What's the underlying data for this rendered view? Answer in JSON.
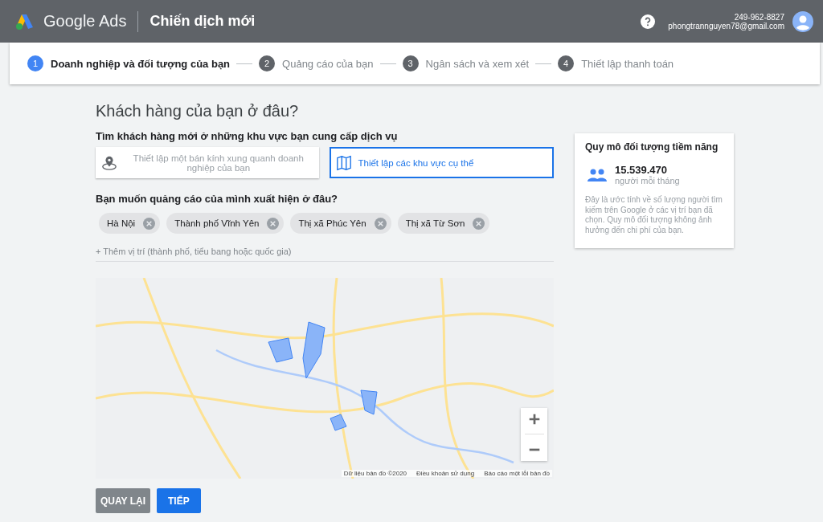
{
  "header": {
    "product": "Google Ads",
    "title": "Chiến dịch mới",
    "account_id": "249-962-8827",
    "email": "phongtrannguyen78@gmail.com"
  },
  "steps": [
    {
      "number": "1",
      "label": "Doanh nghiệp và đối tượng của bạn",
      "selected": true
    },
    {
      "number": "2",
      "label": "Quảng cáo của bạn",
      "selected": false
    },
    {
      "number": "3",
      "label": "Ngân sách và xem xét",
      "selected": false
    },
    {
      "number": "4",
      "label": "Thiết lập thanh toán",
      "selected": false
    }
  ],
  "page_title": "Khách hàng của bạn ở đâu?",
  "area_question": "Tìm khách hàng mới ở những khu vực bạn cung cấp dịch vụ",
  "area_options": [
    {
      "kind": "radius",
      "label": "Thiết lập một bán kính xung quanh doanh nghiệp của bạn",
      "selected": false
    },
    {
      "kind": "regions",
      "label": "Thiết lập các khu vực cụ thể",
      "selected": true
    }
  ],
  "location_question": "Bạn muốn quảng cáo của mình xuất hiện ở đâu?",
  "locations": [
    "Hà Nội",
    "Thành phố Vĩnh Yên",
    "Thị xã Phúc Yên",
    "Thị xã Từ Sơn"
  ],
  "add_location": "+ Thêm vị trí (thành phố, tiểu bang hoặc quốc gia)",
  "map": {
    "footer": [
      "Dữ liệu bản đồ ©2020",
      "Điều khoản sử dụng",
      "Báo cáo một lỗi bản đồ"
    ]
  },
  "buttons": {
    "back": "QUAY LẠI",
    "next": "TIẾP"
  },
  "audience": {
    "title": "Quy mô đối tượng tiềm năng",
    "count": "15.539.470",
    "unit": "người mỗi tháng",
    "note": "Đây là ước tính về số lượng người tìm kiếm trên Google ở các vị trí bạn đã chọn. Quy mô đối tượng không ảnh hưởng đến chi phí của bạn."
  }
}
